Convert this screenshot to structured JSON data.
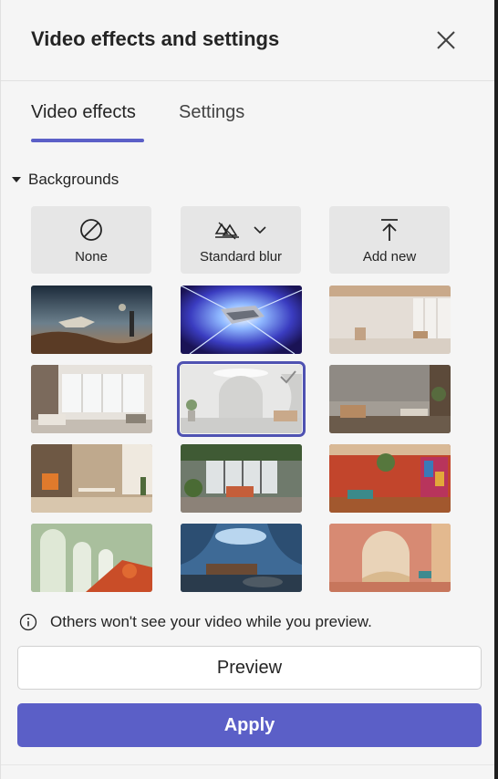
{
  "header": {
    "title": "Video effects and settings",
    "close_icon": "close-icon"
  },
  "tabs": [
    {
      "label": "Video effects",
      "active": true
    },
    {
      "label": "Settings",
      "active": false
    }
  ],
  "section": {
    "label": "Backgrounds",
    "expanded": true
  },
  "options": [
    {
      "label": "None",
      "icon": "none-icon"
    },
    {
      "label": "Standard blur",
      "icon": "blur-icon"
    },
    {
      "label": "Add new",
      "icon": "upload-icon"
    }
  ],
  "backgrounds": [
    {
      "name": "planet-landscape",
      "selected": false
    },
    {
      "name": "hyperspace",
      "selected": false
    },
    {
      "name": "minimal-room",
      "selected": false
    },
    {
      "name": "living-room-windows",
      "selected": false
    },
    {
      "name": "white-arch-room",
      "selected": true
    },
    {
      "name": "concrete-lounge",
      "selected": false
    },
    {
      "name": "warm-dining-room",
      "selected": false
    },
    {
      "name": "plant-patio",
      "selected": false
    },
    {
      "name": "red-courtyard",
      "selected": false
    },
    {
      "name": "green-arch-hall",
      "selected": false
    },
    {
      "name": "blue-dome-lounge",
      "selected": false
    },
    {
      "name": "desert-arch",
      "selected": false
    }
  ],
  "info": {
    "text": "Others won't see your video while you preview.",
    "icon": "info-icon"
  },
  "buttons": {
    "preview": "Preview",
    "apply": "Apply"
  },
  "colors": {
    "accent": "#5b5fc7",
    "panel": "#f5f5f5",
    "option_bg": "#e6e6e6"
  }
}
